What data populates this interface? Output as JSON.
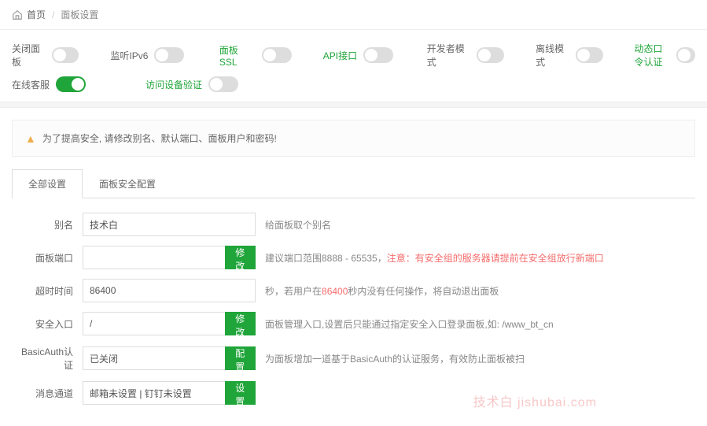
{
  "breadcrumb": {
    "home": "首页",
    "current": "面板设置"
  },
  "toggles": {
    "close_panel": {
      "label": "关闭面板",
      "on": false
    },
    "listen_ipv6": {
      "label": "监听IPv6",
      "on": false
    },
    "panel_ssl": {
      "label": "面板SSL",
      "on": false,
      "green": true
    },
    "api": {
      "label": "API接口",
      "on": false,
      "green": true
    },
    "dev_mode": {
      "label": "开发者模式",
      "on": false
    },
    "offline": {
      "label": "离线模式",
      "on": false
    },
    "dynamic_pwd": {
      "label": "动态口令认证",
      "on": false,
      "green": true
    },
    "online_service": {
      "label": "在线客服",
      "on": true
    },
    "device_verify": {
      "label": "访问设备验证",
      "on": false,
      "green": true
    }
  },
  "alert": {
    "text": "为了提高安全, 请修改别名、默认端口、面板用户和密码!"
  },
  "tabs": {
    "all": "全部设置",
    "security": "面板安全配置"
  },
  "form": {
    "alias": {
      "label": "别名",
      "value": "技术白",
      "hint": "给面板取个别名"
    },
    "port": {
      "label": "面板端口",
      "value": "",
      "btn": "修改",
      "hint_a": "建议端口范围8888 - 65535，",
      "hint_b": "注意：有安全组的服务器请提前在安全组放行新端口"
    },
    "timeout": {
      "label": "超时时间",
      "value": "86400",
      "hint_a": "秒，若用户在",
      "hint_b": "86400",
      "hint_c": "秒内没有任何操作，将自动退出面板"
    },
    "entry": {
      "label": "安全入口",
      "value": "/",
      "btn": "修改",
      "hint": "面板管理入口,设置后只能通过指定安全入口登录面板,如: /www_bt_cn"
    },
    "basicauth": {
      "label": "BasicAuth认证",
      "value": "已关闭",
      "btn": "配置",
      "hint": "为面板增加一道基于BasicAuth的认证服务，有效防止面板被扫"
    },
    "msg": {
      "label": "消息通道",
      "value": "邮箱未设置 | 钉钉未设置",
      "btn": "设置"
    }
  },
  "watermark": "技术白 jishubai.com"
}
